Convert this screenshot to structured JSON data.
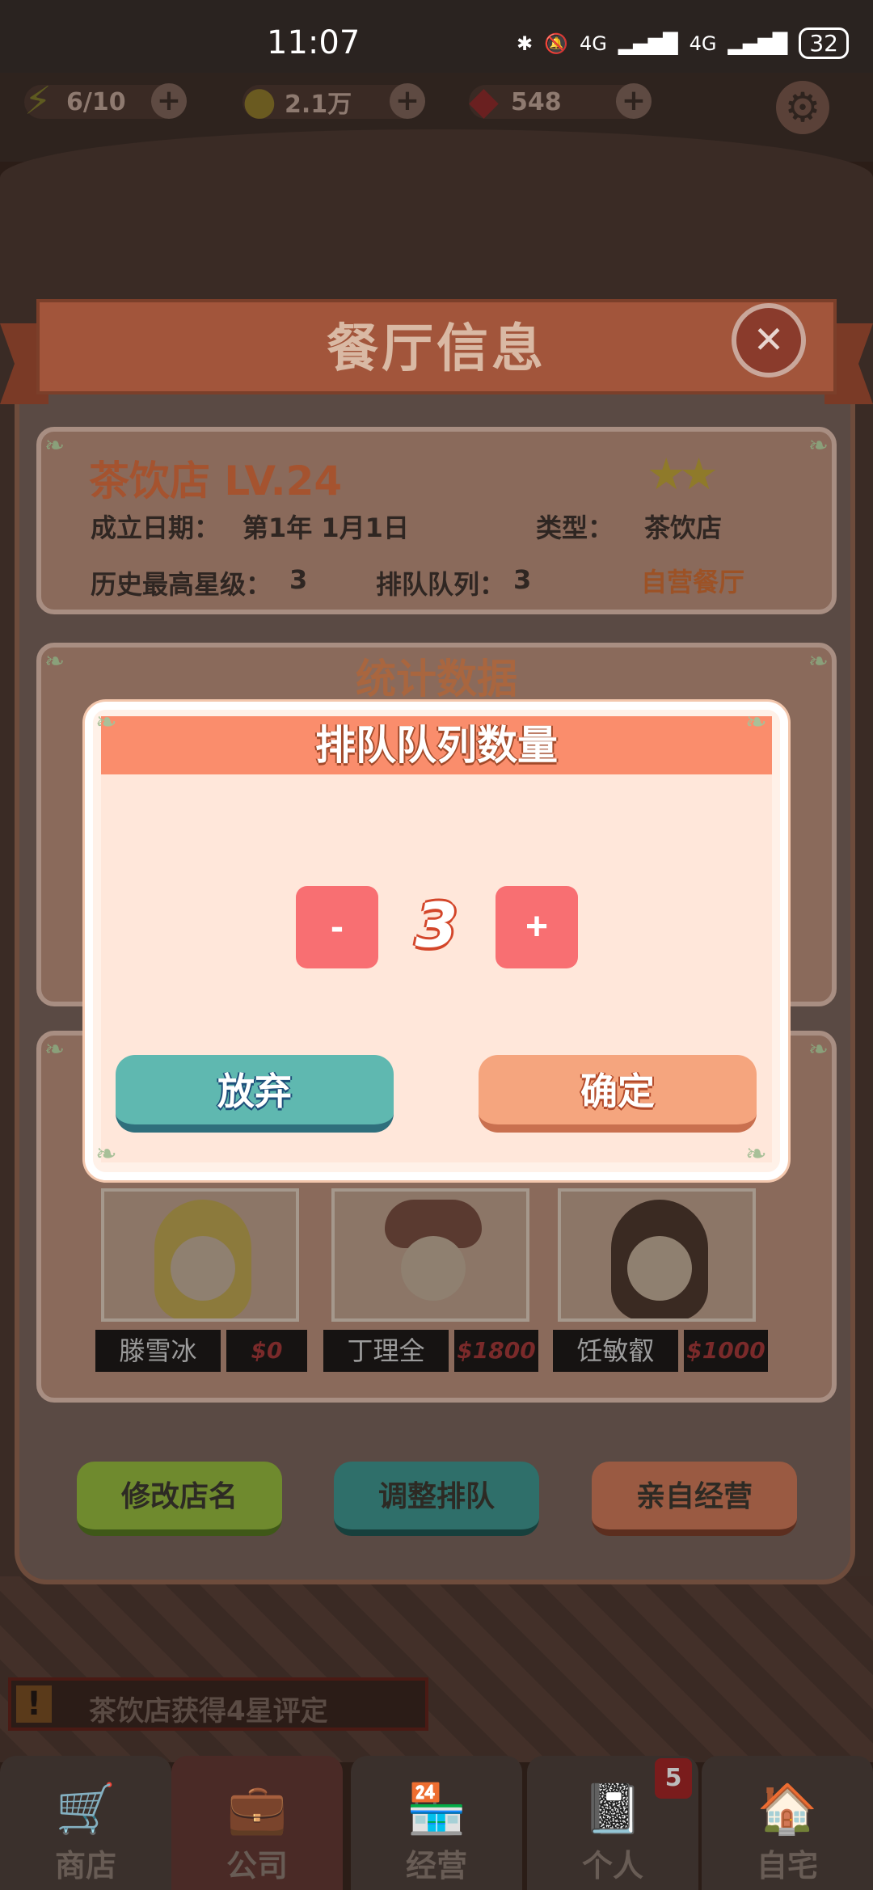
{
  "status_bar": {
    "time": "11:07",
    "network1": "4G",
    "network2": "4G",
    "battery": "32"
  },
  "resources": {
    "energy": "6/10",
    "coins": "2.1万",
    "gems": "548"
  },
  "panel": {
    "title": "餐厅信息",
    "shop_name": "茶饮店 LV.24",
    "stars": "★★",
    "founded_label": "成立日期：",
    "founded_value": "第1年 1月1日",
    "type_label": "类型：",
    "type_value": "茶饮店",
    "max_star_label": "历史最高星级：",
    "max_star_value": "3",
    "queue_label": "排队队列：",
    "queue_value": "3",
    "self_run": "自营餐厅",
    "stats_title": "统计数据"
  },
  "staff": [
    {
      "name": "滕雪冰",
      "price": "$0"
    },
    {
      "name": "丁理全",
      "price": "$1800"
    },
    {
      "name": "饪敏叡",
      "price": "$1000"
    }
  ],
  "actions": {
    "rename": "修改店名",
    "adjust_queue": "调整排队",
    "self_manage": "亲自经营"
  },
  "modal": {
    "title": "排队队列数量",
    "minus": "-",
    "quantity": "3",
    "plus": "+",
    "cancel": "放弃",
    "confirm": "确定"
  },
  "marquee": {
    "icon": "!",
    "text": "茶饮店获得4星评定"
  },
  "nav": {
    "items": [
      {
        "label": "商店",
        "icon": "cart-icon"
      },
      {
        "label": "公司",
        "icon": "briefcase-icon"
      },
      {
        "label": "经营",
        "icon": "storefront-icon"
      },
      {
        "label": "个人",
        "icon": "notebook-icon"
      },
      {
        "label": "自宅",
        "icon": "house-icon"
      }
    ],
    "badge": "5"
  },
  "colors": {
    "accent": "#fa8d6c",
    "stepper": "#f86f72",
    "cancel": "#5fb8b0",
    "confirm": "#f5a57e"
  }
}
